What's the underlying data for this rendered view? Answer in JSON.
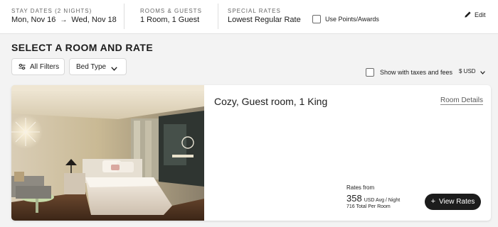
{
  "header": {
    "stay_dates": {
      "label": "STAY DATES (2 NIGHTS)",
      "check_in": "Mon, Nov 16",
      "check_out": "Wed, Nov 18",
      "arrow_icon": "arrow-right-icon"
    },
    "rooms_guests": {
      "label": "ROOMS & GUESTS",
      "value": "1 Room, 1 Guest"
    },
    "special_rates": {
      "label": "SPECIAL RATES",
      "value": "Lowest Regular Rate"
    },
    "points_awards": {
      "label": "Use Points/Awards",
      "checked": false
    },
    "edit": {
      "label": "Edit",
      "icon": "pencil-icon"
    }
  },
  "section": {
    "title": "SELECT A ROOM AND RATE"
  },
  "filters": {
    "all_filters": {
      "label": "All Filters",
      "icon": "sliders-icon"
    },
    "bed_type": {
      "label": "Bed Type",
      "icon": "chevron-down-icon"
    },
    "show_taxes": {
      "label": "Show with taxes and fees",
      "checked": false
    },
    "currency": {
      "label": "$ USD",
      "icon": "chevron-down-icon"
    }
  },
  "room": {
    "name": "Cozy, Guest room, 1 King",
    "details_link": "Room Details",
    "rates_from_label": "Rates from",
    "price": "358",
    "price_unit": "USD Avg / Night",
    "total": "716 Total Per Room",
    "view_rates": "View Rates",
    "view_rates_icon": "plus-icon"
  },
  "colors": {
    "accent": "#1c1c1c",
    "page_bg": "#f3f3f3",
    "card_bg": "#ffffff",
    "muted_text": "#666666"
  }
}
